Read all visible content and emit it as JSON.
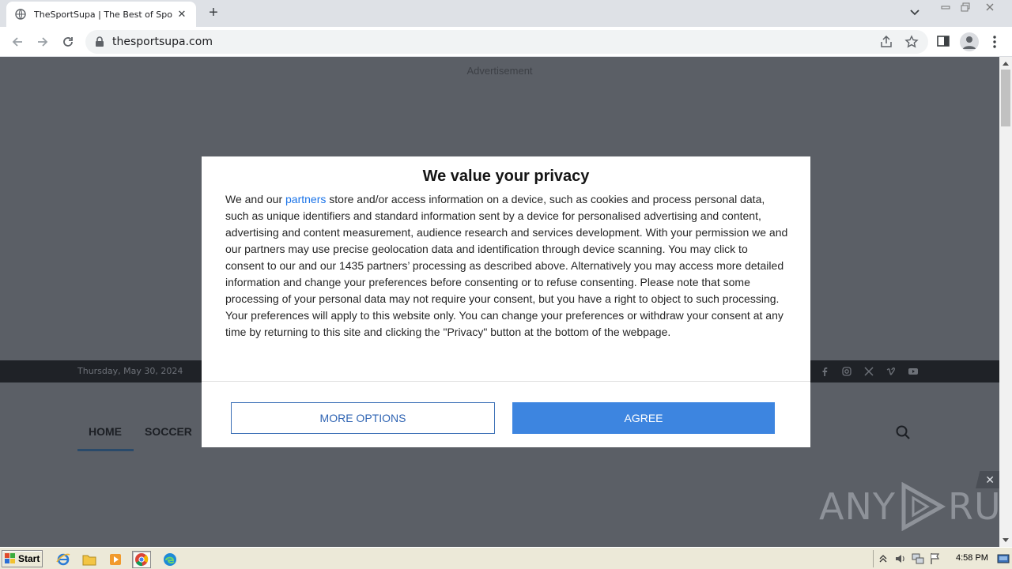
{
  "browser": {
    "tab_title": "TheSportSupa | The Best of Sports N",
    "url": "thesportsupa.com"
  },
  "page": {
    "ad_label": "Advertisement",
    "date": "Thursday, May 30, 2024",
    "menu": [
      "HOME",
      "SOCCER"
    ],
    "watermark_left": "ANY",
    "watermark_right": "RUN"
  },
  "dialog": {
    "title": "We value your privacy",
    "body_prefix": "We and our ",
    "body_link": "partners",
    "body_text": " store and/or access information on a device, such as cookies and process personal data, such as unique identifiers and standard information sent by a device for personalised advertising and content, advertising and content measurement, audience research and services development. With your permission we and our partners may use precise geolocation data and identification through device scanning. You may click to consent to our and our 1435 partners’ processing as described above. Alternatively you may access more detailed information and change your preferences before consenting or to refuse consenting. Please note that some processing of your personal data may not require your consent, but you have a right to object to such processing. Your preferences will apply to this website only. You can change your preferences or withdraw your consent at any time by returning to this site and clicking the \"Privacy\" button at the bottom of the webpage.",
    "more_options_label": "MORE OPTIONS",
    "agree_label": "AGREE"
  },
  "taskbar": {
    "start_label": "Start",
    "clock": "4:58 PM"
  },
  "colors": {
    "overlay": "#5b5f66",
    "accent": "#3d85e0",
    "link": "#1a73e8"
  }
}
